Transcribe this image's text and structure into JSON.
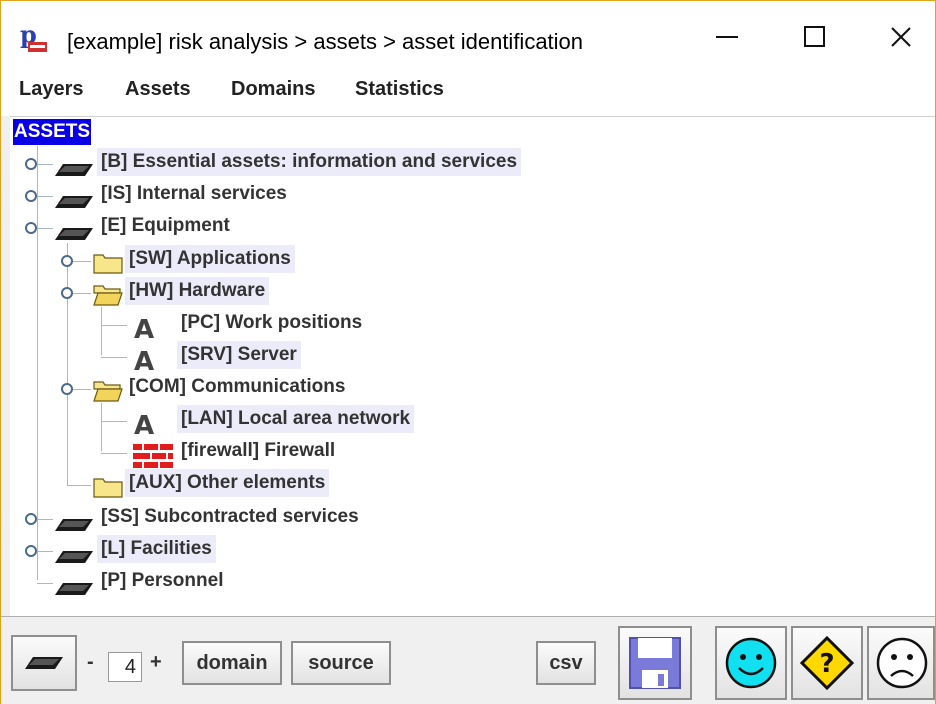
{
  "window": {
    "title": "[example] risk analysis > assets > asset identification",
    "accent_color": "#e3a21a"
  },
  "menu": [
    "Layers",
    "Assets",
    "Domains",
    "Statistics"
  ],
  "tree": {
    "root": "ASSETS",
    "nodes": [
      {
        "label": "[B] Essential assets: information and services",
        "icon": "layer-icon",
        "level": 0,
        "state": "collapsed"
      },
      {
        "label": "[IS] Internal services",
        "icon": "layer-icon",
        "level": 0,
        "state": "collapsed"
      },
      {
        "label": "[E] Equipment",
        "icon": "layer-icon",
        "level": 0,
        "state": "expanded"
      },
      {
        "label": "[SW] Applications",
        "icon": "folder-icon",
        "level": 1,
        "state": "collapsed"
      },
      {
        "label": "[HW] Hardware",
        "icon": "folder-open-icon",
        "level": 1,
        "state": "expanded"
      },
      {
        "label": "[PC] Work positions",
        "icon": "asset-a-icon",
        "level": 2,
        "state": "leaf"
      },
      {
        "label": "[SRV] Server",
        "icon": "asset-a-icon",
        "level": 2,
        "state": "leaf"
      },
      {
        "label": "[COM] Communications",
        "icon": "folder-open-icon",
        "level": 1,
        "state": "expanded"
      },
      {
        "label": "[LAN] Local area network",
        "icon": "asset-a-icon",
        "level": 2,
        "state": "leaf"
      },
      {
        "label": "[firewall] Firewall",
        "icon": "firewall-icon",
        "level": 2,
        "state": "leaf"
      },
      {
        "label": "[AUX] Other elements",
        "icon": "folder-icon",
        "level": 1,
        "state": "leaf"
      },
      {
        "label": "[SS] Subcontracted services",
        "icon": "layer-icon",
        "level": 0,
        "state": "collapsed"
      },
      {
        "label": "[L] Facilities",
        "icon": "layer-icon",
        "level": 0,
        "state": "collapsed"
      },
      {
        "label": "[P] Personnel",
        "icon": "layer-icon",
        "level": 0,
        "state": "leaf"
      }
    ]
  },
  "toolbar": {
    "minus": "-",
    "depth_value": "4",
    "plus": "+",
    "domain_label": "domain",
    "source_label": "source",
    "csv_label": "csv"
  }
}
